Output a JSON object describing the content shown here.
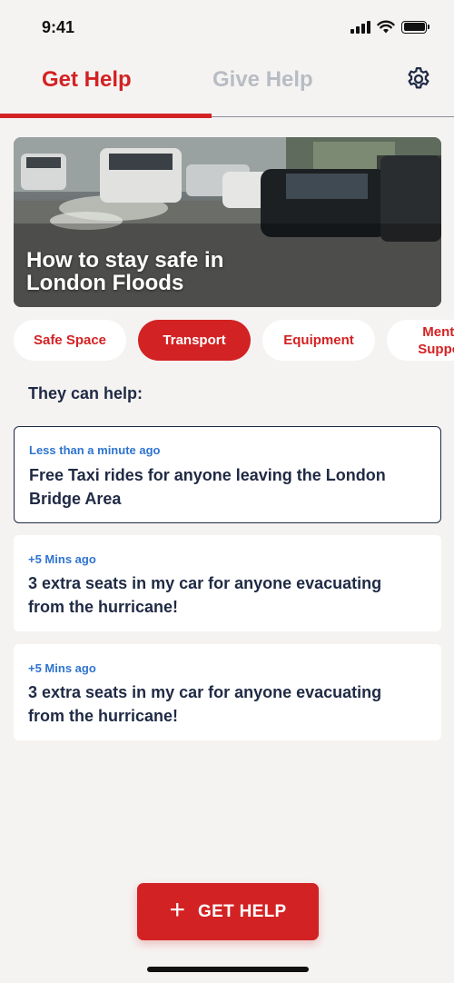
{
  "status_bar": {
    "time": "9:41"
  },
  "tabs": [
    {
      "label": "Get Help",
      "active": true
    },
    {
      "label": "Give Help",
      "active": false
    }
  ],
  "hero": {
    "title": "How to stay safe in London Floods"
  },
  "categories": [
    {
      "label": "Safe Space",
      "selected": false
    },
    {
      "label": "Transport",
      "selected": true
    },
    {
      "label": "Equipment",
      "selected": false
    },
    {
      "label": "Mental Support",
      "selected": false
    }
  ],
  "section_title": "They can help:",
  "offers": [
    {
      "time": "Less than a minute ago",
      "text": "Free Taxi rides for anyone leaving the London Bridge Area"
    },
    {
      "time": "+5 Mins ago",
      "text": "3 extra seats in my car for anyone evacuating from the hurricane!"
    },
    {
      "time": "+5 Mins ago",
      "text": "3 extra seats in my car for anyone evacuating from the hurricane!"
    }
  ],
  "action_button": {
    "icon": "plus-icon",
    "plus_glyph": "+",
    "label": "GET HELP"
  },
  "colors": {
    "primary": "#d32223",
    "text": "#1f2a44",
    "link": "#2f74d0",
    "inactive": "#b8bcc3",
    "background": "#f5f3f2"
  }
}
